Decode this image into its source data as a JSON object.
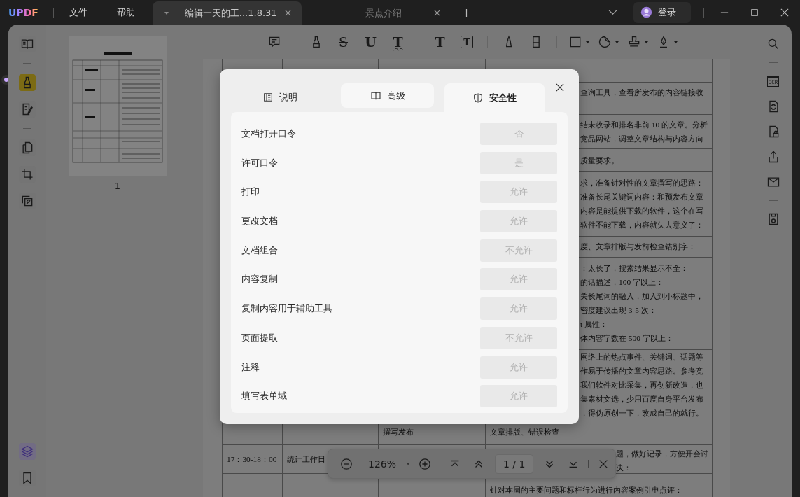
{
  "app": {
    "logo": "UPDF"
  },
  "menus": [
    "文件",
    "帮助"
  ],
  "doc_tabs": [
    {
      "title": "编辑一天的工...1.8.31",
      "selected": true
    },
    {
      "title": "景点介绍",
      "selected": false
    }
  ],
  "account": {
    "label": "登录"
  },
  "left_rail": [
    {
      "kind": "reader",
      "selected": false
    },
    {
      "kind": "comment",
      "selected": true
    },
    {
      "kind": "edit",
      "selected": false
    },
    {
      "kind": "organize",
      "selected": false
    },
    {
      "kind": "crop",
      "selected": false
    },
    {
      "kind": "batch",
      "selected": false
    }
  ],
  "left_rail_bottom": [
    {
      "kind": "layers",
      "selected": true
    },
    {
      "kind": "bookmarks",
      "selected": false
    }
  ],
  "thumbnails": [
    {
      "label": "1"
    }
  ],
  "toolbar": [
    {
      "kind": "comment",
      "menu": false
    },
    {
      "kind": "highlight",
      "menu": false
    },
    {
      "kind": "strikethrough",
      "glyph": "S",
      "menu": false
    },
    {
      "kind": "underline",
      "glyph": "U",
      "menu": false
    },
    {
      "kind": "squiggly",
      "glyph": "T",
      "menu": false
    },
    {
      "kind": "text",
      "glyph": "T",
      "menu": false
    },
    {
      "kind": "textbox",
      "glyph": "T",
      "menu": false
    },
    {
      "kind": "pencil",
      "menu": false
    },
    {
      "kind": "eraser",
      "menu": false
    },
    {
      "kind": "shape",
      "menu": true
    },
    {
      "kind": "sticker",
      "menu": true
    },
    {
      "kind": "stamp",
      "menu": true
    },
    {
      "kind": "signature",
      "menu": true
    }
  ],
  "right_rail": [
    {
      "kind": "search"
    },
    {
      "kind": "ocr",
      "glyph": "OCR"
    },
    {
      "kind": "convert"
    },
    {
      "kind": "protect"
    },
    {
      "kind": "share"
    },
    {
      "kind": "email"
    },
    {
      "kind": "save"
    }
  ],
  "document": {
    "clipped_cells": [
      [
        "查询工具，查看所发布的内容链接收"
      ],
      [
        "结未收录和排名非前 10 的文章。分析",
        "竞品网站，调整文章结构与内容方向"
      ],
      [
        "质量要求。"
      ],
      [
        "求，准备针对性的文章撰写的思路：",
        "准备长尾关键词内容：和预发布文章",
        "内容是能提供下载的软件，这个在写",
        "软件不能下载，内容就失去意义了："
      ],
      [
        "度、文章排版与发前检查错别字："
      ],
      [
        "：太长了，搜索结果显示不全：",
        "的话描述，100 字以上：",
        "关长尾词的融入，加入到小标题中，",
        "密度建议出现 3-5 次：",
        "t 属性：",
        "体内容字数在 500 字以上："
      ],
      [
        "网络上的热点事件、关键词、话题等",
        "作易于传播的文章内容思路。参考竞",
        "我们软件对比采集，再创新改造，也",
        "集素材文选，少用百度自身平台发布",
        "，得伪原创一下，改成自己的就行。"
      ]
    ],
    "lower_rows": [
      {
        "column_3": "撰写发布",
        "column_4": [
          "文章排版、错误检查"
        ]
      },
      {
        "column_1": "17：30-18：00",
        "column_2": "统计工作日",
        "column_4": [
          "题，做好记录，方便开会讨",
          "决："
        ]
      },
      {
        "column_4": [
          "针对本周的主要问题和标杆行为进行内容案例引申点评："
        ]
      }
    ]
  },
  "zoom_bar": {
    "zoom": "126%",
    "page": "1 / 1"
  },
  "dialog": {
    "tabs": [
      {
        "kind": "description",
        "label": "说明",
        "selected": false,
        "hovered": false
      },
      {
        "kind": "advanced",
        "label": "高级",
        "selected": false,
        "hovered": true
      },
      {
        "kind": "security",
        "label": "安全性",
        "selected": true,
        "hovered": false
      }
    ],
    "rows": [
      {
        "label": "文档打开口令",
        "value": "否"
      },
      {
        "label": "许可口令",
        "value": "是"
      },
      {
        "label": "打印",
        "value": "允许"
      },
      {
        "label": "更改文档",
        "value": "允许"
      },
      {
        "label": "文档组合",
        "value": "不允许"
      },
      {
        "label": "内容复制",
        "value": "允许"
      },
      {
        "label": "复制内容用于辅助工具",
        "value": "允许"
      },
      {
        "label": "页面提取",
        "value": "不允许"
      },
      {
        "label": "注释",
        "value": "允许"
      },
      {
        "label": "填写表单域",
        "value": "允许"
      }
    ]
  }
}
